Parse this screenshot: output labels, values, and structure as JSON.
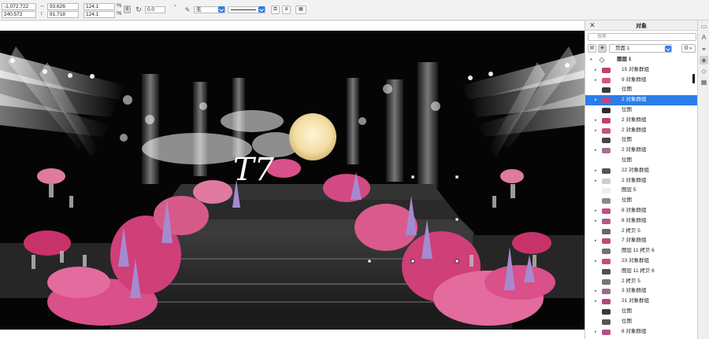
{
  "toolbar": {
    "pos_x": "-1,072.722",
    "pos_y": "240.572",
    "width": "93.626",
    "height": "91.718",
    "scale_w": "124.1",
    "scale_h": "124.1",
    "percent": "%",
    "rotation": "0.0",
    "degree": "°",
    "outline_label": "无"
  },
  "docker": {
    "title": "对象",
    "search_placeholder": "搜索",
    "page_label": "页面 1",
    "rows": [
      {
        "kind": "layer",
        "name": "图层 1",
        "arrow": "▾"
      },
      {
        "name": "15 对象群组",
        "arrow": "▸",
        "thumb": "#c0406a"
      },
      {
        "name": "9 对象群组",
        "arrow": "▸",
        "thumb": "#d0587a"
      },
      {
        "name": "位图",
        "arrow": "",
        "thumb": "#3a3a3a"
      },
      {
        "name": "2 对象群组",
        "arrow": "▸",
        "thumb": "#b8497a",
        "selected": true
      },
      {
        "name": "位图",
        "arrow": "",
        "thumb": "#2e2e2e"
      },
      {
        "name": "2 对象群组",
        "arrow": "▸",
        "thumb": "#c04070"
      },
      {
        "name": "2 对象群组",
        "arrow": "▸",
        "thumb": "#c55080"
      },
      {
        "name": "位图",
        "arrow": "",
        "thumb": "#444444"
      },
      {
        "name": "2 对象群组",
        "arrow": "▸",
        "thumb": "#a07090"
      },
      {
        "name": "位图",
        "arrow": "",
        "thumb": "#ffffff"
      },
      {
        "name": "22 对象群组",
        "arrow": "▸",
        "thumb": "#555555"
      },
      {
        "name": "2 对象群组",
        "arrow": "▸",
        "thumb": "#cccccc"
      },
      {
        "name": "图层 5",
        "arrow": "",
        "thumb": "#eeeeee"
      },
      {
        "name": "位图",
        "arrow": "",
        "thumb": "#888888"
      },
      {
        "name": "8 对象群组",
        "arrow": "▸",
        "thumb": "#c0507a"
      },
      {
        "name": "8 对象群组",
        "arrow": "▸",
        "thumb": "#b05a88"
      },
      {
        "name": "2 拷贝 5",
        "arrow": "",
        "thumb": "#666666"
      },
      {
        "name": "7 对象群组",
        "arrow": "▸",
        "thumb": "#c04a70"
      },
      {
        "name": "图层 11 拷贝 6",
        "arrow": "",
        "thumb": "#707070"
      },
      {
        "name": "23 对象群组",
        "arrow": "▸",
        "thumb": "#c84a78"
      },
      {
        "name": "图层 11 拷贝 6",
        "arrow": "",
        "thumb": "#505050"
      },
      {
        "name": "2 拷贝 5",
        "arrow": "",
        "thumb": "#777777"
      },
      {
        "name": "3 对象群组",
        "arrow": "▸",
        "thumb": "#9a6a8a"
      },
      {
        "name": "21 对象群组",
        "arrow": "▸",
        "thumb": "#b04a78"
      },
      {
        "name": "位图",
        "arrow": "",
        "thumb": "#3a3a3a"
      },
      {
        "name": "位图",
        "arrow": "",
        "thumb": "#555555"
      },
      {
        "name": "8 对象群组",
        "arrow": "▸",
        "thumb": "#b85082"
      }
    ]
  },
  "canvas": {
    "logo_text": "T7",
    "colors": {
      "stage_bg": "#050505",
      "moon": "#f3e2b0",
      "flower_pink": "#d9508a",
      "flower_lavender": "#a58ad0",
      "selection_blue": "#2b7de9"
    }
  },
  "rail": {
    "icons": [
      "properties-icon",
      "text-icon",
      "transform-icon",
      "objects-icon",
      "tag-icon",
      "layout-icon"
    ]
  }
}
